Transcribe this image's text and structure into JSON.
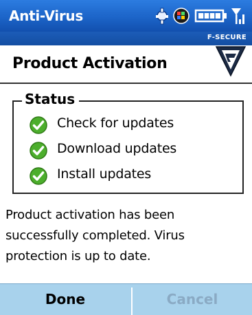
{
  "window": {
    "title": "Anti-Virus"
  },
  "status_icons": [
    "sync-icon",
    "messaging-icon",
    "battery-icon",
    "signal-icon"
  ],
  "brand": {
    "name": "F-SECURE"
  },
  "page": {
    "title": "Product Activation"
  },
  "status_group": {
    "title": "Status",
    "steps": [
      {
        "label": "Check for updates",
        "state": "done"
      },
      {
        "label": "Download updates",
        "state": "done"
      },
      {
        "label": "Install updates",
        "state": "done"
      }
    ]
  },
  "message": "Product activation has been successfully completed. Virus protection is up to date.",
  "softkeys": {
    "left": "Done",
    "right": "Cancel",
    "right_enabled": false
  },
  "colors": {
    "titlebar": "#1c64c8",
    "bottom_bar": "#a8d2ec",
    "check_green": "#4cae2c",
    "disabled_text": "#8aaac4"
  }
}
